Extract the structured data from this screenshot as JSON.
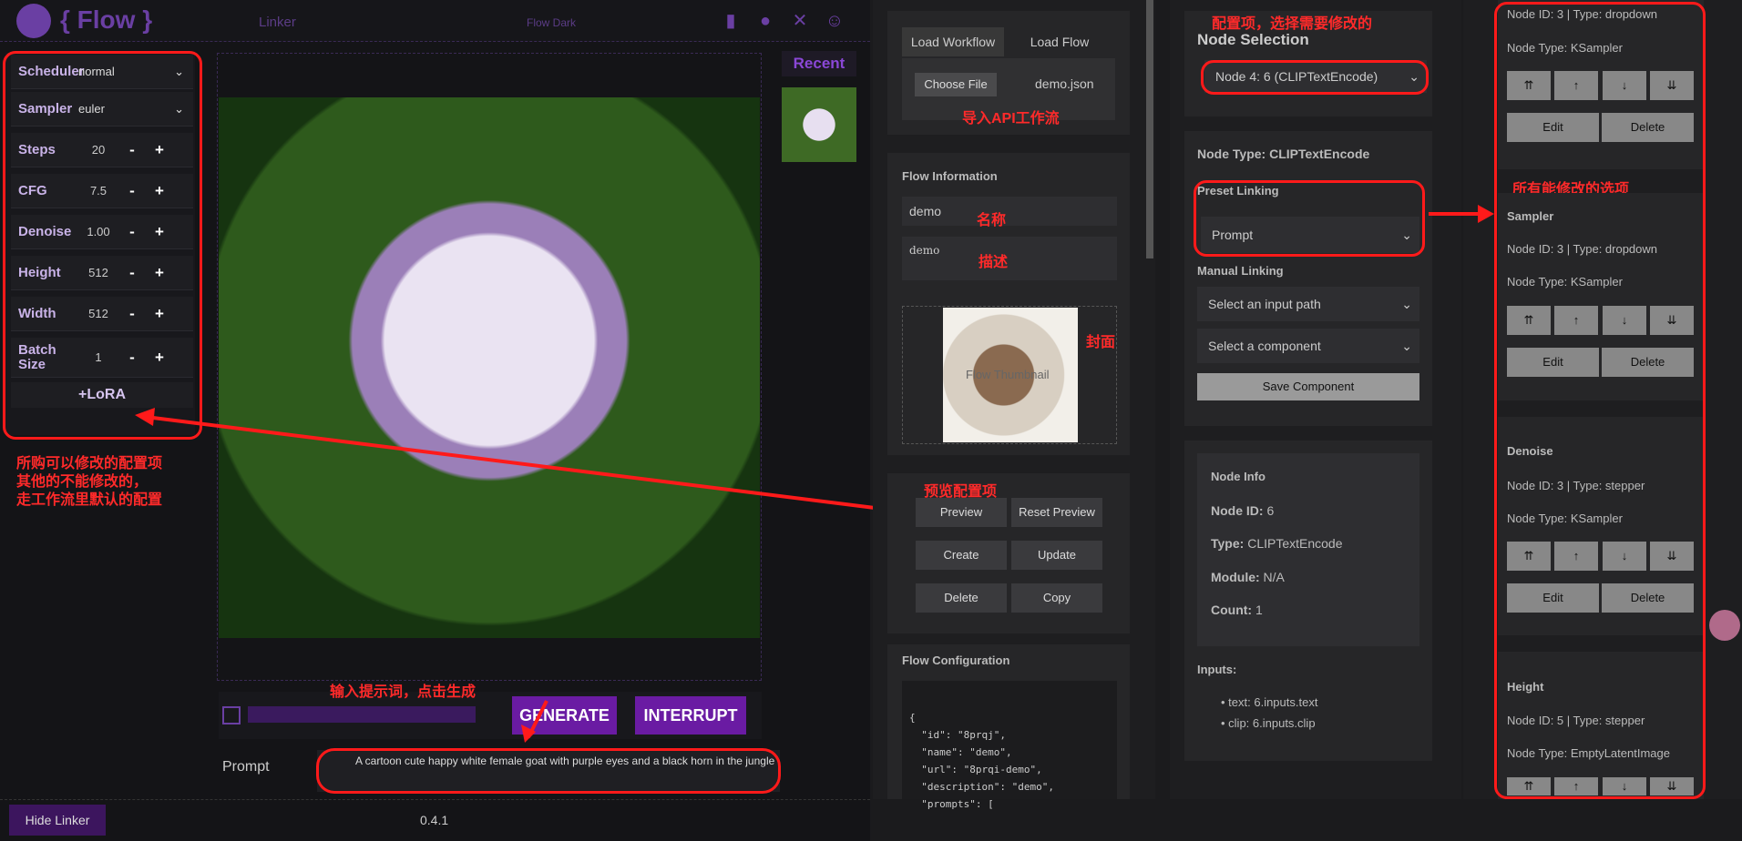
{
  "app": {
    "logo": "{ Flow }",
    "tab_linker": "Linker",
    "theme": "Flow Dark",
    "version": "0.4.1",
    "hide_linker": "Hide Linker",
    "recent": "Recent"
  },
  "settings": {
    "scheduler": {
      "label": "Scheduler",
      "value": "normal"
    },
    "sampler": {
      "label": "Sampler",
      "value": "euler"
    },
    "steps": {
      "label": "Steps",
      "value": "20"
    },
    "cfg": {
      "label": "CFG",
      "value": "7.5"
    },
    "denoise": {
      "label": "Denoise",
      "value": "1.00"
    },
    "height": {
      "label": "Height",
      "value": "512"
    },
    "width": {
      "label": "Width",
      "value": "512"
    },
    "batch": {
      "label": "Batch Size",
      "value": "1"
    },
    "lora": "+LoRA",
    "minus": "-",
    "plus": "+"
  },
  "actions": {
    "generate": "GENERATE",
    "interrupt": "INTERRUPT",
    "prompt_label": "Prompt",
    "prompt_value": "A cartoon cute happy white female goat with purple eyes and a black horn in the jungle"
  },
  "annotations": {
    "config_note": "所购可以修改的配置项\n其他的不能修改的，\n走工作流里默认的配置",
    "prompt_note": "输入提示词，点击生成",
    "import_note": "导入API工作流",
    "name_note": "名称",
    "desc_note": "描述",
    "cover_note": "封面",
    "preview_note": "预览配置项",
    "select_note": "配置项，选择需要修改的",
    "options_note": "所有能修改的选项"
  },
  "workflow": {
    "tab_load_workflow": "Load Workflow",
    "tab_load_flow": "Load Flow",
    "choose_file": "Choose File",
    "file_name": "demo.json",
    "info_title": "Flow Information",
    "name": "demo",
    "description": "demo",
    "thumb_alt": "Flow Thumbnail",
    "preview": "Preview",
    "reset_preview": "Reset Preview",
    "create": "Create",
    "update": "Update",
    "delete": "Delete",
    "copy": "Copy",
    "config_title": "Flow Configuration",
    "config_lines": [
      "{",
      "  \"id\": \"8prqj\",",
      "  \"name\": \"demo\",",
      "  \"url\": \"8prqi-demo\",",
      "  \"description\": \"demo\",",
      "  \"prompts\": ["
    ]
  },
  "nodes": {
    "selection_title": "Node Selection",
    "selected": "Node 4: 6 (CLIPTextEncode)",
    "node_type": "Node Type: CLIPTextEncode",
    "preset_title": "Preset Linking",
    "preset_value": "Prompt",
    "manual_title": "Manual Linking",
    "input_path": "Select an input path",
    "component": "Select a component",
    "save": "Save Component",
    "info_title": "Node Info",
    "id_label": "Node ID:",
    "id_value": "6",
    "type_label": "Type:",
    "type_value": "CLIPTextEncode",
    "module_label": "Module:",
    "module_value": "N/A",
    "count_label": "Count:",
    "count_value": "1",
    "inputs_title": "Inputs:",
    "inputs": [
      "text: 6.inputs.text",
      "clip: 6.inputs.clip"
    ]
  },
  "components": [
    {
      "title": "",
      "meta": "Node ID: 3 | Type: dropdown",
      "type": "Node Type: KSampler"
    },
    {
      "title": "Sampler",
      "meta": "Node ID: 3 | Type: dropdown",
      "type": "Node Type: KSampler"
    },
    {
      "title": "Denoise",
      "meta": "Node ID: 3 | Type: stepper",
      "type": "Node Type: KSampler"
    },
    {
      "title": "Height",
      "meta": "Node ID: 5 | Type: stepper",
      "type": "Node Type: EmptyLatentImage"
    }
  ],
  "comp_buttons": {
    "top": "⇈",
    "up": "↑",
    "down": "↓",
    "bottom": "⇊",
    "edit": "Edit",
    "delete": "Delete"
  }
}
